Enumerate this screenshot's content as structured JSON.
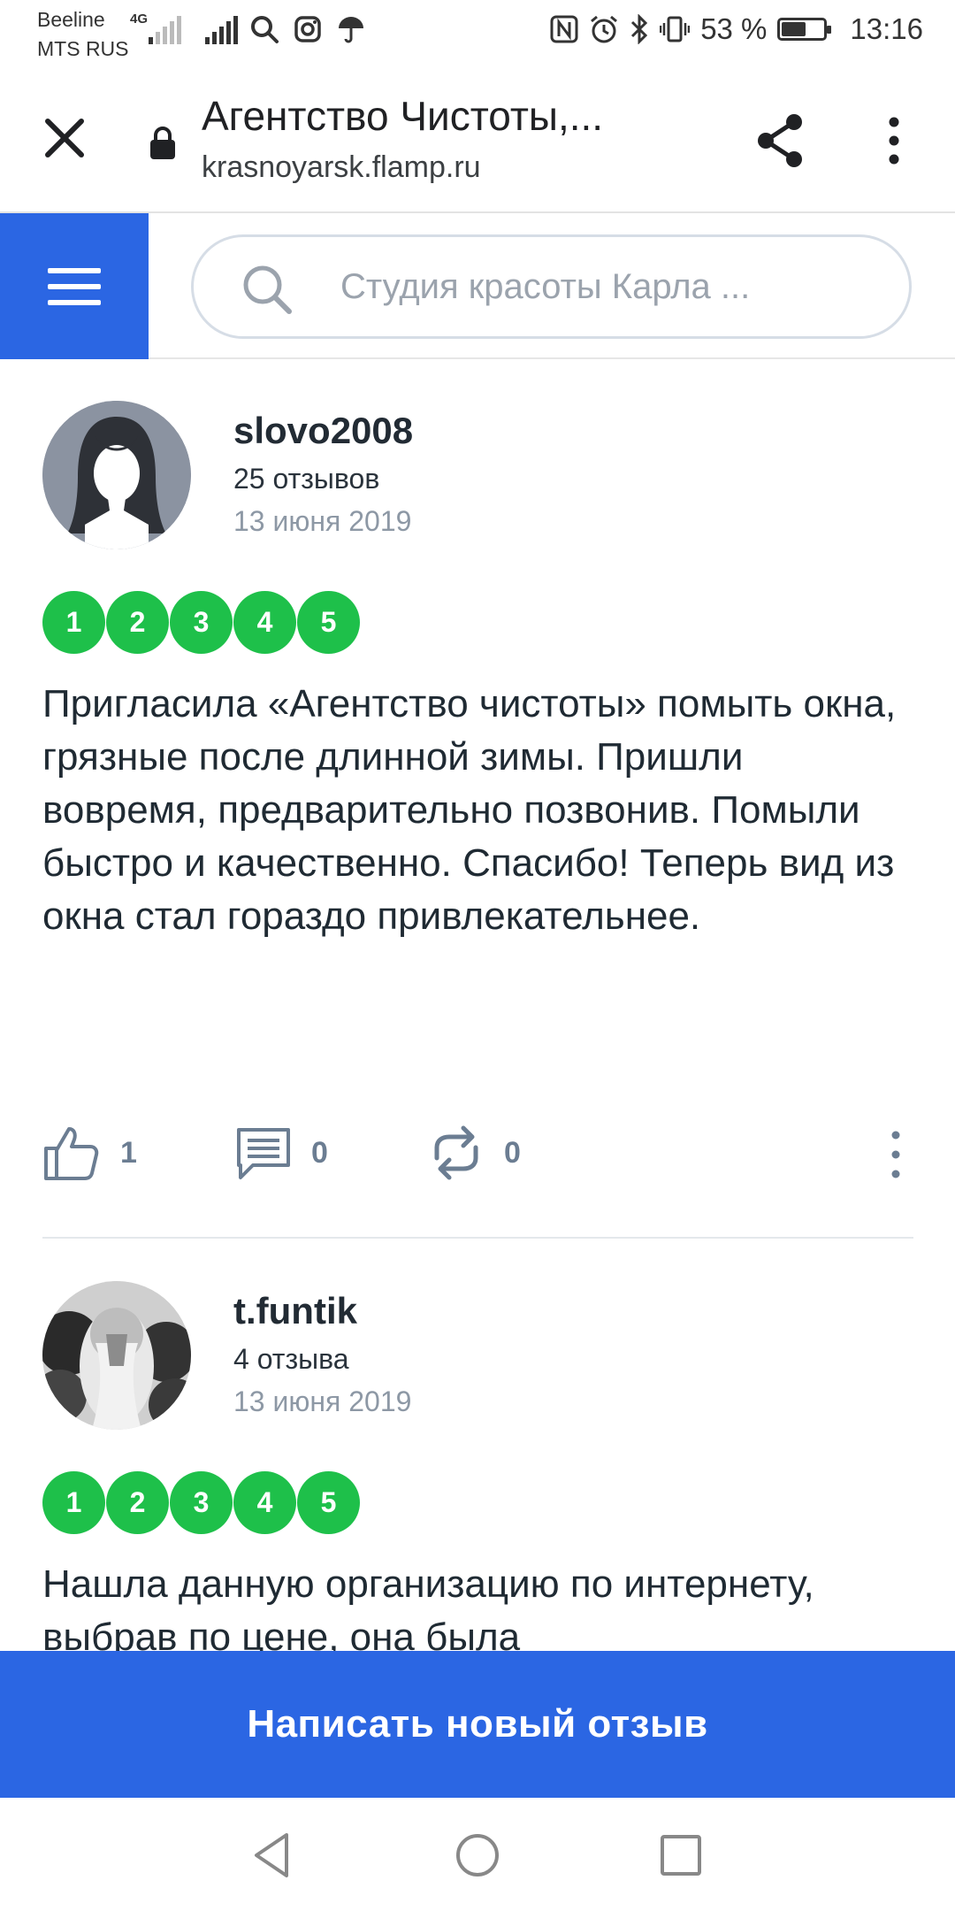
{
  "status_bar": {
    "carrier_1": "Beeline",
    "carrier_2": "MTS RUS",
    "network_type": "4G",
    "battery_text": "53 %",
    "battery_level_percent": 53,
    "time": "13:16",
    "icons": [
      "signal-icon",
      "search-icon",
      "instagram-icon",
      "umbrella-icon",
      "nfc-icon",
      "alarm-icon",
      "bluetooth-icon",
      "vibrate-icon",
      "battery-icon"
    ]
  },
  "browser": {
    "title": "Агентство Чистоты,...",
    "url": "krasnoyarsk.flamp.ru"
  },
  "site_header": {
    "search_placeholder": "Студия красоты Карла ..."
  },
  "reviews": [
    {
      "author": "slovo2008",
      "review_count": "25 отзывов",
      "date": "13 июня 2019",
      "rating": [
        "1",
        "2",
        "3",
        "4",
        "5"
      ],
      "text": "Пригласила «Агентство чистоты» помыть окна, грязные после длинной зимы. Пришли вовремя, предварительно позвонив. Помыли быстро и качественно. Спасибо! Теперь вид из окна стал гораздо привлекательнее.",
      "likes": "1",
      "comments": "0",
      "reposts": "0"
    },
    {
      "author": "t.funtik",
      "review_count": "4 отзыва",
      "date": "13 июня 2019",
      "rating": [
        "1",
        "2",
        "3",
        "4",
        "5"
      ],
      "text": "Нашла данную организацию по интернету, выбрав по цене, она была"
    }
  ],
  "cta": {
    "label": "Написать новый отзыв"
  },
  "colors": {
    "brand_blue": "#2b66e3",
    "rating_green": "#1ec04a",
    "muted_text": "#8d98a5"
  }
}
